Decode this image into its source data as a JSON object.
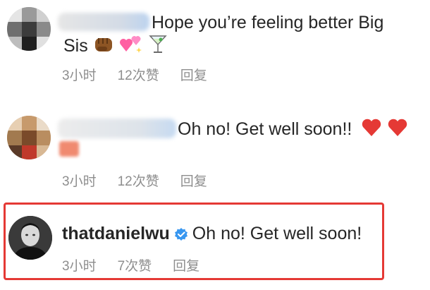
{
  "comments": [
    {
      "text_line1": "Hope you’re feeling better Big",
      "text_line2": "Sis",
      "emojis": [
        "fist-emoji",
        "sparkling-hearts-emoji",
        "cocktail-emoji"
      ],
      "time": "3小时",
      "likes": "12次赞",
      "reply": "回复"
    },
    {
      "text": "Oh no! Get well soon!!",
      "emojis": [
        "red-heart-emoji",
        "red-heart-emoji"
      ],
      "time": "3小时",
      "likes": "12次赞",
      "reply": "回复"
    },
    {
      "username": "thatdanielwu",
      "text": "Oh no! Get well soon!",
      "time": "3小时",
      "likes": "7次赞",
      "reply": "回复"
    }
  ],
  "colors": {
    "highlight": "#e53935",
    "verified": "#3897f0",
    "meta": "#8e8e8e"
  }
}
